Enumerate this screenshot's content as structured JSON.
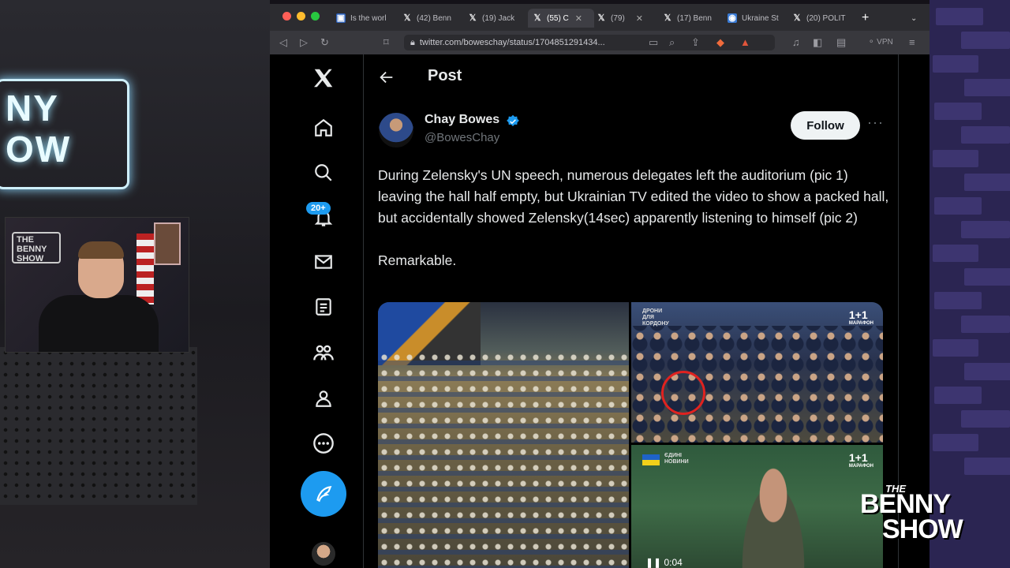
{
  "overlay": {
    "neon_sign": [
      "NY",
      "OW"
    ],
    "webcam_logo": [
      "THE",
      "BENNY",
      "SHOW"
    ],
    "brand_logo": {
      "the": "THE",
      "line1": "BENNY",
      "line2": "SHOW"
    }
  },
  "browser": {
    "tabs": [
      {
        "title": "Is the worl",
        "icon": "news-icon",
        "active": false
      },
      {
        "title": "(42) Benn",
        "icon": "x-logo-icon",
        "active": false
      },
      {
        "title": "(19) Jack",
        "icon": "x-logo-icon",
        "active": false
      },
      {
        "title": "(55) C",
        "icon": "x-logo-icon",
        "active": true
      },
      {
        "title": "(79)",
        "icon": "x-logo-icon",
        "active": false
      },
      {
        "title": "(17) Benn",
        "icon": "x-logo-icon",
        "active": false
      },
      {
        "title": "Ukraine St",
        "icon": "web-icon",
        "active": false
      },
      {
        "title": "(20) POLIT",
        "icon": "x-logo-icon",
        "active": false
      }
    ],
    "new_tab": "+",
    "url": "twitter.com/boweschay/status/1704851291434...",
    "vpn_label": "VPN"
  },
  "twitter": {
    "notifications_badge": "20+",
    "header_title": "Post",
    "author": {
      "name": "Chay Bowes",
      "handle": "@BowesChay",
      "verified": true
    },
    "follow_label": "Follow",
    "more_label": "···",
    "tweet_text": "During Zelensky's UN speech, numerous delegates left the auditorium (pic 1) leaving the hall half empty, but Ukrainian TV edited the video to show a packed hall, but accidentally showed Zelensky(14sec) apparently listening to himself (pic 2)\n\nRemarkable.",
    "media": {
      "channel_logo": "1+1",
      "channel_sub": "МАРАФОН",
      "pic2_caption": [
        "ДРОНИ",
        "ДЛЯ",
        "КОРДОНУ"
      ],
      "pic3_caption": [
        "ЄДИНІ",
        "НОВИНИ"
      ],
      "video_time": "0:04"
    }
  },
  "colors": {
    "accent": "#1d9bf0",
    "background": "#000000",
    "text": "#e7e9ea",
    "muted": "#71767b"
  }
}
